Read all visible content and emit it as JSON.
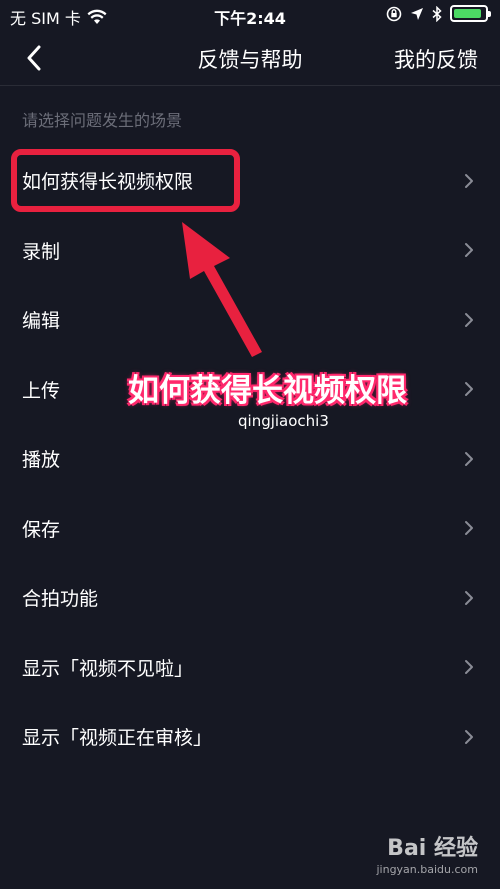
{
  "status_bar": {
    "carrier": "无 SIM 卡",
    "time": "下午2:44",
    "battery_level": 0.9,
    "icons": [
      "wifi-icon",
      "orientation-lock-icon",
      "location-icon",
      "bluetooth-icon",
      "battery-icon"
    ]
  },
  "nav": {
    "title": "反馈与帮助",
    "right_label": "我的反馈",
    "back_icon": "chevron-left-icon"
  },
  "section_header": "请选择问题发生的场景",
  "items": [
    {
      "label": "如何获得长视频权限"
    },
    {
      "label": "录制"
    },
    {
      "label": "编辑"
    },
    {
      "label": "上传"
    },
    {
      "label": "播放"
    },
    {
      "label": "保存"
    },
    {
      "label": "合拍功能"
    },
    {
      "label": "显示「视频不见啦」"
    },
    {
      "label": "显示「视频正在审核」"
    }
  ],
  "annotation": {
    "text": "如何获得长视频权限",
    "username": "qingjiaochi3",
    "color": "#e8213f"
  },
  "watermark": {
    "brand": "Bai 经验",
    "url": "jingyan.baidu.com"
  },
  "colors": {
    "background": "#161823",
    "secondary_text": "#6b6d78",
    "chevron": "#8a8c96"
  }
}
